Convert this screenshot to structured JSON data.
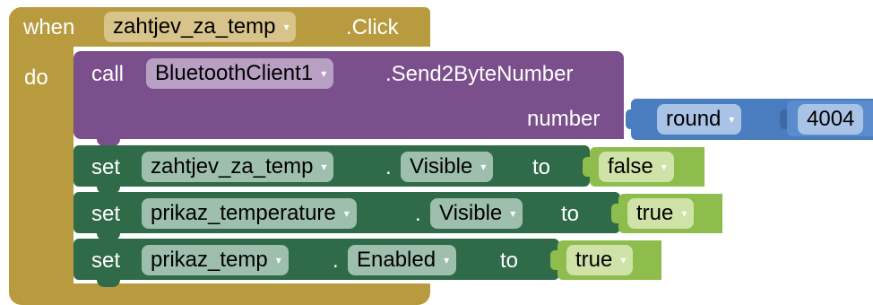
{
  "event_block": {
    "keyword_when": "when",
    "component": "zahtjev_za_temp",
    "event": ".Click",
    "keyword_do": "do"
  },
  "call_block": {
    "keyword_call": "call",
    "component": "BluetoothClient1",
    "method": ".Send2ByteNumber",
    "param_label": "number"
  },
  "round_block": {
    "function": "round",
    "number": "4004"
  },
  "set_blocks": [
    {
      "keyword": "set",
      "component": "zahtjev_za_temp",
      "dot": ".",
      "property": "Visible",
      "to": "to",
      "value": "false"
    },
    {
      "keyword": "set",
      "component": "prikaz_temperature",
      "dot": ".",
      "property": "Visible",
      "to": "to",
      "value": "true"
    },
    {
      "keyword": "set",
      "component": "prikaz_temp",
      "dot": ".",
      "property": "Enabled",
      "to": "to",
      "value": "true"
    }
  ],
  "dropdown_arrow_glyph": "▾",
  "colors": {
    "event_block": "#b79b3e",
    "procedure_call_block": "#7b4e8c",
    "component_setter_block": "#2f6a49",
    "logic_block": "#8fbd4d",
    "math_block": "#4a7dbf"
  }
}
